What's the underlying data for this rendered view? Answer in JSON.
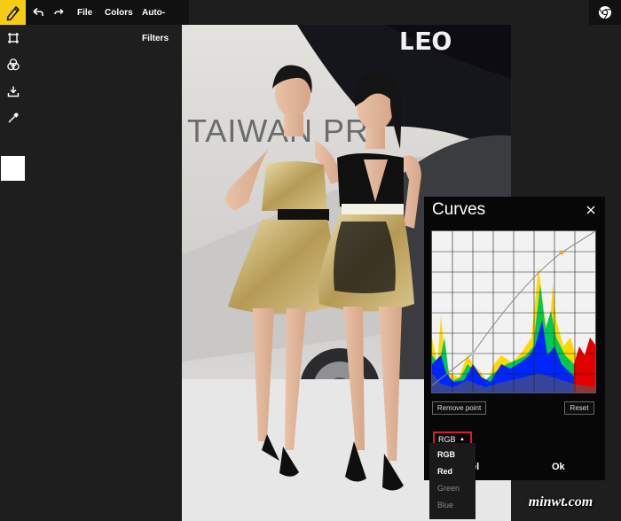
{
  "toolbar": {
    "menu": [
      {
        "label": "File"
      },
      {
        "label": "Colors"
      },
      {
        "label": "Auto-Filters"
      }
    ],
    "accent_color": "#f5cd15",
    "icons": [
      "pencil-icon",
      "undo-icon",
      "redo-icon",
      "chrome-icon"
    ]
  },
  "sidebar": {
    "tools": [
      "crop-icon",
      "color-circles-icon",
      "download-icon",
      "eyedropper-icon"
    ],
    "current_color": "#ffffff"
  },
  "photo": {
    "backdrop_text": "TAIWAN PR"
  },
  "curves": {
    "title": "Curves",
    "remove_point_label": "Remove point",
    "reset_label": "Reset",
    "channel_selected": "RGB",
    "channel_options": [
      "RGB",
      "Red",
      "Green",
      "Blue"
    ],
    "cancel_partial": "el",
    "ok_label": "Ok"
  },
  "watermark": {
    "text": "minwt.com"
  }
}
